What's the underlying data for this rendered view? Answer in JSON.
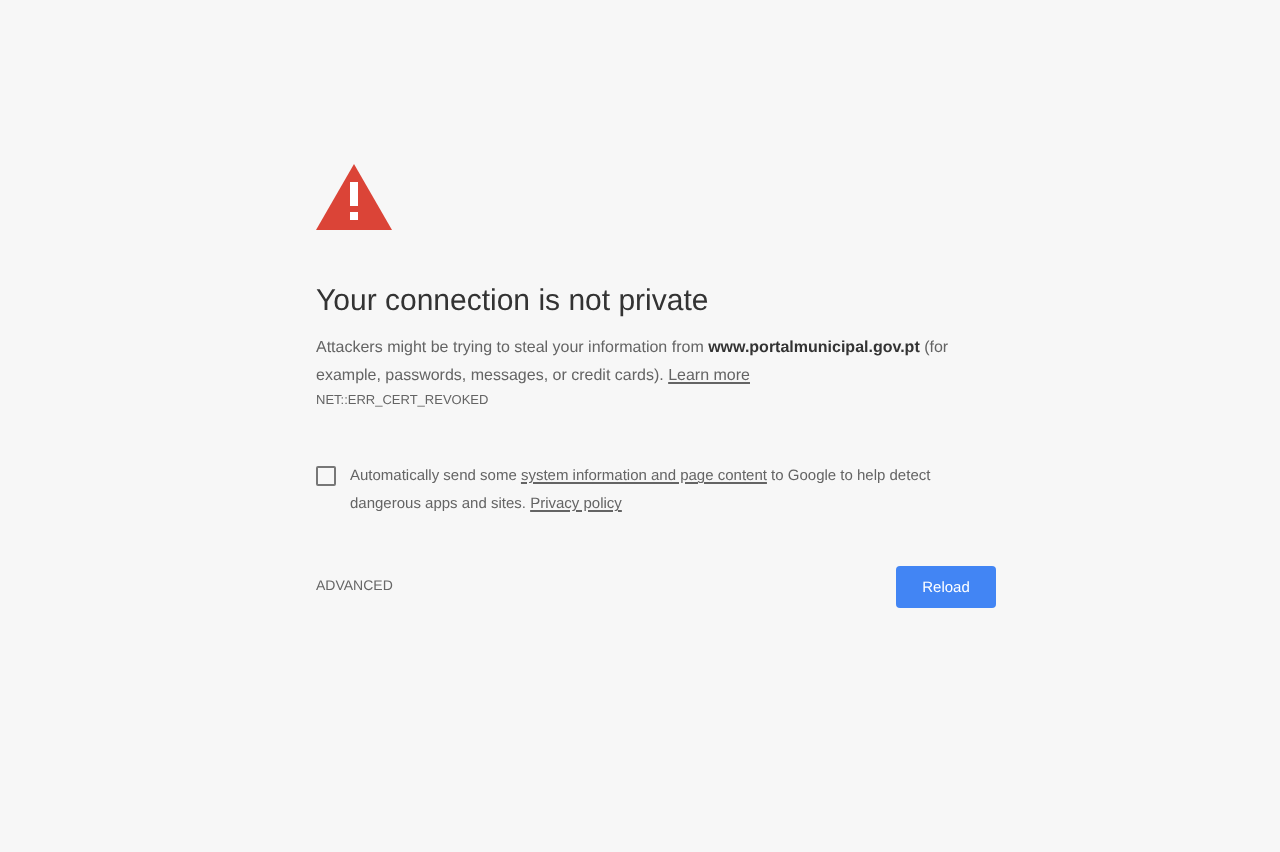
{
  "title": "Your connection is not private",
  "message": {
    "text": "Attackers might be trying to steal your information from **www.portalmunicipal.gov.pt** (for example, passwords, messages, or credit cards).",
    "link": "Learn more"
  },
  "error_code": "NET::ERR_CERT_REVOKED",
  "opt_in": {
    "checked": false,
    "text_before": "Automatically send some",
    "link_1": "system information and page content",
    "text_middle": "to Google to help detect dangerous apps and sites.",
    "link_2": "Privacy policy"
  },
  "advanced_link": "ADVANCED",
  "reload_button": "Reload"
}
